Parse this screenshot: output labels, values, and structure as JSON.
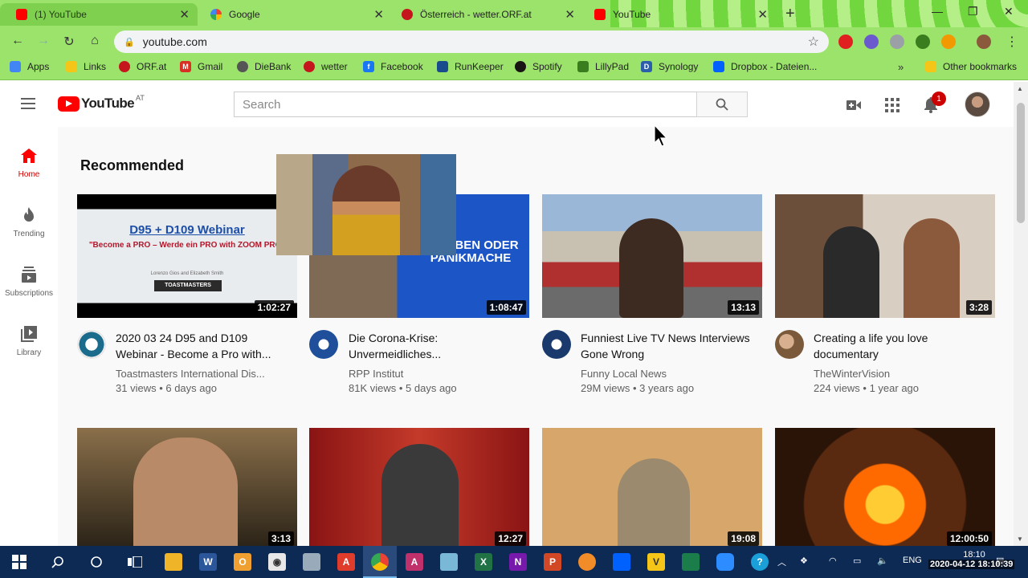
{
  "browser": {
    "tabs": [
      {
        "title": "(1) YouTube",
        "color": "#ff0000"
      },
      {
        "title": "Google",
        "color": "#4285f4"
      },
      {
        "title": "Österreich - wetter.ORF.at",
        "color": "#c4161c"
      },
      {
        "title": "YouTube",
        "color": "#ff0000"
      }
    ],
    "url": "youtube.com",
    "bookmarks": [
      {
        "label": "Apps",
        "color": "#4285f4"
      },
      {
        "label": "Links",
        "color": "#f5c518"
      },
      {
        "label": "ORF.at",
        "color": "#c4161c"
      },
      {
        "label": "Gmail",
        "color": "#d93025"
      },
      {
        "label": "DieBank",
        "color": "#555555"
      },
      {
        "label": "wetter",
        "color": "#c4161c"
      },
      {
        "label": "Facebook",
        "color": "#1877f2"
      },
      {
        "label": "RunKeeper",
        "color": "#1a4b8c"
      },
      {
        "label": "Spotify",
        "color": "#191414"
      },
      {
        "label": "LillyPad",
        "color": "#3a7d1f"
      },
      {
        "label": "Synology",
        "color": "#2b5fab"
      },
      {
        "label": "Dropbox - Dateien...",
        "color": "#0061ff"
      }
    ],
    "other_bookmarks": "Other bookmarks"
  },
  "youtube": {
    "logo_text": "YouTube",
    "country": "AT",
    "search_placeholder": "Search",
    "notification_count": "1",
    "guide": [
      {
        "label": "Home",
        "icon": "home-icon"
      },
      {
        "label": "Trending",
        "icon": "trending-icon"
      },
      {
        "label": "Subscriptions",
        "icon": "subscriptions-icon"
      },
      {
        "label": "Library",
        "icon": "library-icon"
      }
    ],
    "shelf_title": "Recommended",
    "videos": [
      {
        "title": "2020 03 24 D95 and D109 Webinar - Become a Pro with...",
        "channel": "Toastmasters International Dis...",
        "meta": "31 views • 6 days ago",
        "duration": "1:02:27",
        "thumb_text_1": "D95 + D109 Webinar",
        "thumb_text_2": "\"Become a PRO – Werde ein PRO with ZOOM PRO\"",
        "thumb_text_3": "Lorenzo Gios and Elizabeth Smith",
        "thumb_text_4": "TOASTMASTERS"
      },
      {
        "title": "Die Corona-Krise: Unvermeidliches...",
        "channel": "RPP Institut",
        "meta": "81K views • 5 days ago",
        "duration": "1:08:47",
        "thumb_text_1": "STERBEN ODER PANIKMACHE"
      },
      {
        "title": "Funniest Live TV News Interviews Gone Wrong",
        "channel": "Funny Local News",
        "meta": "29M views • 3 years ago",
        "duration": "13:13"
      },
      {
        "title": "Creating a life you love documentary",
        "channel": "TheWinterVision",
        "meta": "224 views • 1 year ago",
        "duration": "3:28"
      },
      {
        "duration": "3:13"
      },
      {
        "duration": "12:27"
      },
      {
        "duration": "19:08"
      },
      {
        "duration": "12:00:50"
      }
    ]
  },
  "taskbar": {
    "lang": "ENG",
    "time": "18:10",
    "stamp": "2020-04-12 18:10:39"
  }
}
